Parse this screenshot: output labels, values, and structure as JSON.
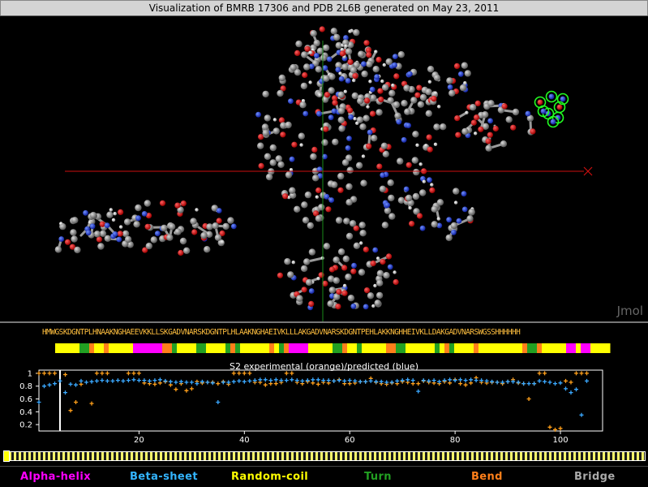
{
  "title": "Visualization of BMRB 17306 and PDB 2L6B generated on May 23, 2011",
  "viewer": {
    "label": "Jmol"
  },
  "sequence": "HMWGSKDGNTPLHNAAKNGHAEEVKKLLSKGADVNARSKDGNTPLHLAAKNGHAEIVKLLLAKGADVNARSKDGNTPEHLAKKNGHHEIVKLLDAKGADVNARSWGSSHHHHHH",
  "chart_data": {
    "type": "scatter",
    "title": "S2 experimental (orange)/predicted (blue)",
    "xticks": [
      20,
      40,
      60,
      80,
      100
    ],
    "yticks": [
      0.2,
      0.4,
      0.6,
      0.8,
      1
    ],
    "xlim": [
      1,
      108
    ],
    "ylim": [
      0.1,
      1.05
    ],
    "marker_x": 5,
    "series": [
      {
        "name": "experimental",
        "color": "#ff9f1a",
        "marker": "+",
        "x": [
          1,
          2,
          3,
          4,
          6,
          7,
          8,
          9,
          11,
          12,
          13,
          14,
          18,
          19,
          20,
          21,
          22,
          23,
          24,
          25,
          26,
          27,
          28,
          29,
          30,
          31,
          32,
          33,
          34,
          35,
          36,
          37,
          38,
          39,
          40,
          41,
          42,
          43,
          44,
          45,
          46,
          47,
          48,
          49,
          50,
          51,
          52,
          53,
          54,
          55,
          56,
          57,
          58,
          59,
          60,
          61,
          62,
          63,
          64,
          65,
          66,
          67,
          68,
          69,
          70,
          71,
          72,
          73,
          74,
          75,
          76,
          77,
          78,
          79,
          80,
          81,
          82,
          83,
          84,
          85,
          86,
          87,
          88,
          89,
          90,
          91,
          92,
          93,
          94,
          95,
          96,
          97,
          98,
          99,
          100,
          101,
          102,
          103,
          104,
          105
        ],
        "y": [
          1.0,
          1.0,
          1.0,
          1.0,
          0.98,
          0.42,
          0.55,
          0.83,
          0.53,
          1.0,
          1.0,
          1.0,
          1.0,
          1.0,
          1.0,
          0.85,
          0.84,
          0.83,
          0.85,
          0.87,
          0.82,
          0.75,
          0.84,
          0.73,
          0.76,
          0.87,
          0.85,
          0.86,
          0.86,
          0.84,
          0.87,
          0.83,
          1.0,
          1.0,
          1.0,
          1.0,
          0.86,
          0.86,
          0.82,
          0.84,
          0.84,
          0.86,
          1.0,
          1.0,
          0.86,
          0.84,
          0.87,
          0.85,
          0.83,
          0.86,
          0.85,
          0.88,
          0.9,
          0.84,
          0.84,
          0.85,
          0.87,
          0.87,
          0.92,
          0.86,
          0.84,
          0.83,
          0.85,
          0.84,
          0.87,
          0.86,
          0.84,
          0.84,
          0.88,
          0.86,
          0.85,
          0.84,
          0.87,
          0.85,
          0.9,
          0.84,
          0.82,
          0.85,
          0.93,
          0.86,
          0.85,
          0.86,
          0.86,
          0.84,
          0.87,
          0.9,
          0.85,
          0.84,
          0.6,
          0.84,
          1.0,
          1.0,
          0.16,
          0.12,
          0.14,
          0.88,
          0.86,
          1.0,
          1.0,
          1.0
        ]
      },
      {
        "name": "predicted",
        "color": "#3aa8ff",
        "marker": "+",
        "x": [
          1,
          2,
          3,
          4,
          5,
          6,
          7,
          8,
          9,
          10,
          11,
          12,
          13,
          14,
          15,
          16,
          17,
          18,
          19,
          20,
          21,
          22,
          23,
          24,
          25,
          26,
          27,
          28,
          29,
          30,
          31,
          32,
          33,
          34,
          35,
          36,
          37,
          38,
          39,
          40,
          41,
          42,
          43,
          44,
          45,
          46,
          47,
          48,
          49,
          50,
          51,
          52,
          53,
          54,
          55,
          56,
          57,
          58,
          59,
          60,
          61,
          62,
          63,
          64,
          65,
          66,
          67,
          68,
          69,
          70,
          71,
          72,
          73,
          74,
          75,
          76,
          77,
          78,
          79,
          80,
          81,
          82,
          83,
          84,
          85,
          86,
          87,
          88,
          89,
          90,
          91,
          92,
          93,
          94,
          95,
          96,
          97,
          98,
          99,
          100,
          101,
          102,
          103,
          104,
          105
        ],
        "y": [
          0.55,
          0.8,
          0.82,
          0.84,
          0.88,
          0.7,
          0.83,
          0.82,
          0.88,
          0.86,
          0.87,
          0.88,
          0.89,
          0.88,
          0.88,
          0.89,
          0.88,
          0.89,
          0.9,
          0.89,
          0.89,
          0.88,
          0.89,
          0.9,
          0.88,
          0.87,
          0.86,
          0.87,
          0.86,
          0.86,
          0.84,
          0.87,
          0.86,
          0.85,
          0.55,
          0.86,
          0.86,
          0.87,
          0.88,
          0.87,
          0.88,
          0.89,
          0.9,
          0.9,
          0.89,
          0.9,
          0.89,
          0.89,
          0.9,
          0.89,
          0.88,
          0.89,
          0.9,
          0.9,
          0.89,
          0.89,
          0.88,
          0.89,
          0.88,
          0.89,
          0.88,
          0.87,
          0.87,
          0.88,
          0.87,
          0.87,
          0.86,
          0.86,
          0.88,
          0.89,
          0.9,
          0.89,
          0.72,
          0.89,
          0.88,
          0.89,
          0.87,
          0.89,
          0.9,
          0.89,
          0.9,
          0.89,
          0.9,
          0.89,
          0.89,
          0.88,
          0.87,
          0.86,
          0.86,
          0.87,
          0.87,
          0.86,
          0.84,
          0.84,
          0.84,
          0.88,
          0.87,
          0.86,
          0.84,
          0.85,
          0.76,
          0.7,
          0.75,
          0.35,
          0.88
        ]
      }
    ]
  },
  "secondary_structure": {
    "colors": {
      "H": "#ff00ff",
      "E": "#33b4ff",
      "C": "#ffff00",
      "T": "#22a022",
      "S": "#ff7f1a",
      "B": "#aaaaaa"
    },
    "codes": "CCCCCTTSCCSCCCCCHHHHHHSSTCCCCTTCCCCTSTCCCCCCSCTSHHHHCCCCCTTSCCTCCCCCSSTTCCCCCCTCSTCCCCSCCCCCCCCCSTTSCCCCCHHCHHCCCC"
  },
  "scrollbar": {
    "value": 0
  },
  "legend": [
    {
      "label": "Alpha-helix",
      "color": "#ff00ff"
    },
    {
      "label": "Beta-sheet",
      "color": "#33b4ff"
    },
    {
      "label": "Random-coil",
      "color": "#ffff00"
    },
    {
      "label": "Turn",
      "color": "#22a022"
    },
    {
      "label": "Bend",
      "color": "#ff7f1a"
    },
    {
      "label": "Bridge",
      "color": "#aaaaaa"
    }
  ]
}
